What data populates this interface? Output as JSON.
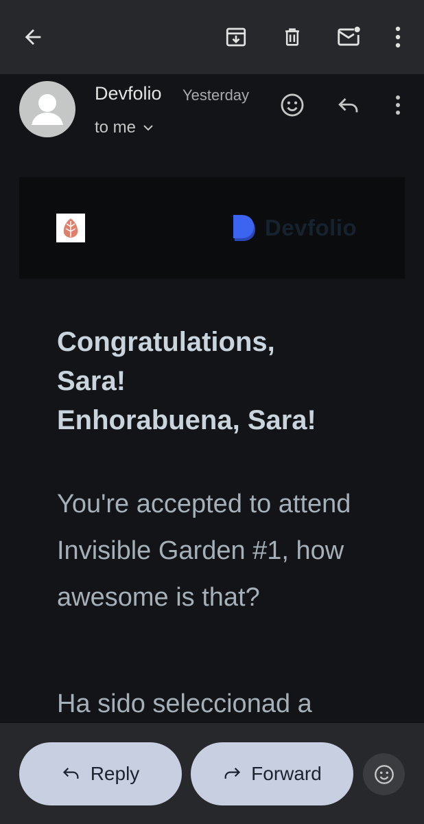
{
  "toolbar": {
    "back_icon": "arrow-left-icon",
    "archive_icon": "archive-icon",
    "delete_icon": "trash-icon",
    "mark_unread_icon": "mail-unread-icon",
    "more_icon": "more-vert-icon"
  },
  "message": {
    "sender": "Devfolio",
    "date": "Yesterday",
    "recipient": "to me"
  },
  "banner": {
    "brand": "Devfolio"
  },
  "body": {
    "headline_line1": "Congratulations,",
    "headline_line2": "Sara!",
    "headline_line3": "Enhorabuena, Sara!",
    "paragraph1": "You're accepted to attend Invisible Garden #1, how awesome is that?",
    "paragraph2": "Ha sido seleccionad a"
  },
  "actions": {
    "reply_label": "Reply",
    "forward_label": "Forward"
  },
  "colors": {
    "background": "#131417",
    "bar": "#26282b",
    "pill": "#c8cfe0",
    "brand_blue": "#3d64f0"
  }
}
